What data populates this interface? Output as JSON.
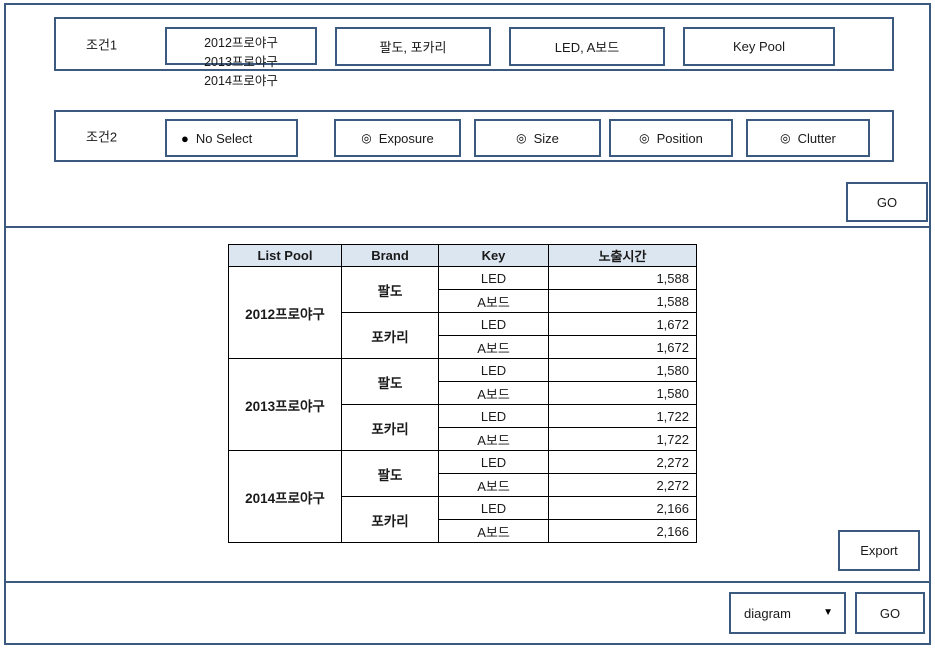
{
  "condition_rows": {
    "row1": {
      "label": "조건1",
      "pool_selector": {
        "options": [
          "2012프로야구",
          "2013프로야구",
          "2014프로야구"
        ]
      },
      "buttons": [
        {
          "id": "brand",
          "label": "팔도, 포카리"
        },
        {
          "id": "key",
          "label": "LED, A보드"
        },
        {
          "id": "pool",
          "label": "Key Pool"
        }
      ]
    },
    "row2": {
      "label": "조건2",
      "options": [
        {
          "id": "no-select",
          "label": "No Select",
          "selected": true,
          "mark": "●"
        },
        {
          "id": "exposure",
          "label": "Exposure",
          "selected": false,
          "mark": "◎"
        },
        {
          "id": "size",
          "label": "Size",
          "selected": false,
          "mark": "◎"
        },
        {
          "id": "position",
          "label": "Position",
          "selected": false,
          "mark": "◎"
        },
        {
          "id": "clutter",
          "label": "Clutter",
          "selected": false,
          "mark": "◎"
        }
      ]
    }
  },
  "actions": {
    "go_top": "GO",
    "export": "Export",
    "go_bottom": "GO"
  },
  "output_select": {
    "value": "diagram",
    "arrow_icon": "▼"
  },
  "table": {
    "columns": [
      "List Pool",
      "Brand",
      "Key",
      "노출시간"
    ],
    "rows": [
      {
        "pool": "2012프로야구",
        "brand": "팔도",
        "key": "LED",
        "time": "1,588"
      },
      {
        "pool": "2012프로야구",
        "brand": "팔도",
        "key": "A보드",
        "time": "1,588"
      },
      {
        "pool": "2012프로야구",
        "brand": "포카리",
        "key": "LED",
        "time": "1,672"
      },
      {
        "pool": "2012프로야구",
        "brand": "포카리",
        "key": "A보드",
        "time": "1,672"
      },
      {
        "pool": "2013프로야구",
        "brand": "팔도",
        "key": "LED",
        "time": "1,580"
      },
      {
        "pool": "2013프로야구",
        "brand": "팔도",
        "key": "A보드",
        "time": "1,580"
      },
      {
        "pool": "2013프로야구",
        "brand": "포카리",
        "key": "LED",
        "time": "1,722"
      },
      {
        "pool": "2013프로야구",
        "brand": "포카리",
        "key": "A보드",
        "time": "1,722"
      },
      {
        "pool": "2014프로야구",
        "brand": "팔도",
        "key": "LED",
        "time": "2,272"
      },
      {
        "pool": "2014프로야구",
        "brand": "팔도",
        "key": "A보드",
        "time": "2,272"
      },
      {
        "pool": "2014프로야구",
        "brand": "포카리",
        "key": "LED",
        "time": "2,166"
      },
      {
        "pool": "2014프로야구",
        "brand": "포카리",
        "key": "A보드",
        "time": "2,166"
      }
    ]
  },
  "colors": {
    "frame_border": "#3c5a80",
    "table_header_bg": "#dce6f1",
    "table_border": "#000000"
  }
}
